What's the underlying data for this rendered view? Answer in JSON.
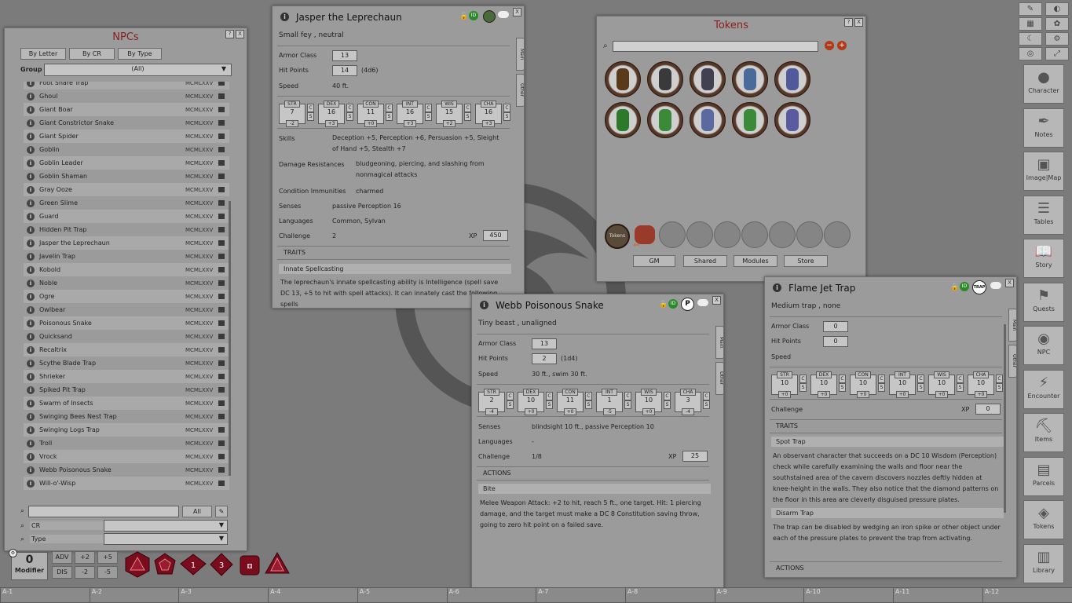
{
  "npcs": {
    "title": "NPCs",
    "filters": [
      "By Letter",
      "By CR",
      "By Type"
    ],
    "group_label": "Group",
    "group_value": "(All)",
    "items": [
      {
        "name": "Foot Snare Trap",
        "v": "MCMLXXV"
      },
      {
        "name": "Ghoul",
        "v": "MCMLXXV"
      },
      {
        "name": "Giant Boar",
        "v": "MCMLXXV"
      },
      {
        "name": "Giant Constrictor Snake",
        "v": "MCMLXXV"
      },
      {
        "name": "Giant Spider",
        "v": "MCMLXXV"
      },
      {
        "name": "Goblin",
        "v": "MCMLXXV"
      },
      {
        "name": "Goblin Leader",
        "v": "MCMLXXV"
      },
      {
        "name": "Goblin Shaman",
        "v": "MCMLXXV"
      },
      {
        "name": "Gray Ooze",
        "v": "MCMLXXV"
      },
      {
        "name": "Green Slime",
        "v": "MCMLXXV"
      },
      {
        "name": "Guard",
        "v": "MCMLXXV"
      },
      {
        "name": "Hidden Pit Trap",
        "v": "MCMLXXV"
      },
      {
        "name": "Jasper the Leprechaun",
        "v": "MCMLXXV"
      },
      {
        "name": "Javelin Trap",
        "v": "MCMLXXV"
      },
      {
        "name": "Kobold",
        "v": "MCMLXXV"
      },
      {
        "name": "Noble",
        "v": "MCMLXXV"
      },
      {
        "name": "Ogre",
        "v": "MCMLXXV"
      },
      {
        "name": "Owlbear",
        "v": "MCMLXXV"
      },
      {
        "name": "Poisonous Snake",
        "v": "MCMLXXV"
      },
      {
        "name": "Quicksand",
        "v": "MCMLXXV"
      },
      {
        "name": "Recaltrix",
        "v": "MCMLXXV"
      },
      {
        "name": "Scythe Blade Trap",
        "v": "MCMLXXV"
      },
      {
        "name": "Shrieker",
        "v": "MCMLXXV"
      },
      {
        "name": "Spiked Pit Trap",
        "v": "MCMLXXV"
      },
      {
        "name": "Swarm of Insects",
        "v": "MCMLXXV"
      },
      {
        "name": "Swinging Bees Nest Trap",
        "v": "MCMLXXV"
      },
      {
        "name": "Swinging Logs Trap",
        "v": "MCMLXXV"
      },
      {
        "name": "Troll",
        "v": "MCMLXXV"
      },
      {
        "name": "Vrock",
        "v": "MCMLXXV"
      },
      {
        "name": "Webb Poisonous Snake",
        "v": "MCMLXXV"
      },
      {
        "name": "Will-o'-Wisp",
        "v": "MCMLXXV"
      }
    ],
    "all_btn": "All",
    "cr_label": "CR",
    "type_label": "Type"
  },
  "jasper": {
    "title": "Jasper the Leprechaun",
    "subtitle": "Small fey , neutral",
    "ac_label": "Armor Class",
    "ac": "13",
    "hp_label": "Hit Points",
    "hp": "14",
    "hp_dice": "(4d6)",
    "speed_label": "Speed",
    "speed": "40 ft.",
    "abilities": [
      {
        "n": "STR",
        "v": "7",
        "m": "-2"
      },
      {
        "n": "DEX",
        "v": "16",
        "m": "+3"
      },
      {
        "n": "CON",
        "v": "11",
        "m": "+0"
      },
      {
        "n": "INT",
        "v": "16",
        "m": "+3"
      },
      {
        "n": "WIS",
        "v": "15",
        "m": "+2"
      },
      {
        "n": "CHA",
        "v": "16",
        "m": "+3"
      }
    ],
    "skills_label": "Skills",
    "skills": "Deception +5, Perception +6, Persuasion +5, Sleight of Hand +5, Stealth +7",
    "dr_label": "Damage Resistances",
    "dr": "bludgeoning, piercing, and slashing from nonmagical attacks",
    "ci_label": "Condition Immunities",
    "ci": "charmed",
    "senses_label": "Senses",
    "senses": "passive Perception 16",
    "lang_label": "Languages",
    "lang": "Common, Sylvan",
    "chal_label": "Challenge",
    "chal": "2",
    "xp_label": "XP",
    "xp": "450",
    "traits": "TRAITS",
    "trait1": "Innate Spellcasting",
    "trait1_text": "The leprechaun's innate spellcasting ability is Intelligence (spell save DC 13, +5 to hit with spell attacks). It can innately cast the following spells",
    "tab_main": "Main",
    "tab_other": "Other"
  },
  "tokens": {
    "title": "Tokens",
    "buttons": [
      "GM",
      "Shared",
      "Modules",
      "Store"
    ],
    "token_label": "Tokens"
  },
  "webb": {
    "title": "Webb Poisonous Snake",
    "subtitle": "Tiny beast , unaligned",
    "ac_label": "Armor Class",
    "ac": "13",
    "hp_label": "Hit Points",
    "hp": "2",
    "hp_dice": "(1d4)",
    "speed_label": "Speed",
    "speed": "30 ft., swim 30 ft.",
    "abilities": [
      {
        "n": "STR",
        "v": "2",
        "m": "-4"
      },
      {
        "n": "DEX",
        "v": "10",
        "m": "+0"
      },
      {
        "n": "CON",
        "v": "11",
        "m": "+0"
      },
      {
        "n": "INT",
        "v": "1",
        "m": "-5"
      },
      {
        "n": "WIS",
        "v": "10",
        "m": "+0"
      },
      {
        "n": "CHA",
        "v": "3",
        "m": "-4"
      }
    ],
    "senses_label": "Senses",
    "senses": "blindsight 10 ft., passive Perception 10",
    "lang_label": "Languages",
    "lang": "-",
    "chal_label": "Challenge",
    "chal": "1/8",
    "xp_label": "XP",
    "xp": "25",
    "actions": "ACTIONS",
    "action1": "Bite",
    "action1_text": "Melee Weapon Attack: +2 to hit, reach 5 ft., one target. Hit: 1 piercing damage, and the target must make a DC 8 Constitution saving throw, going to zero hit point on a failed save.",
    "tab_main": "Main",
    "tab_other": "Other"
  },
  "flame": {
    "title": "Flame Jet Trap",
    "subtitle": "Medium trap , none",
    "ac_label": "Armor Class",
    "ac": "0",
    "hp_label": "Hit Points",
    "hp": "0",
    "speed_label": "Speed",
    "abilities": [
      {
        "n": "STR",
        "v": "10",
        "m": "+0"
      },
      {
        "n": "DEX",
        "v": "10",
        "m": "+0"
      },
      {
        "n": "CON",
        "v": "10",
        "m": "+0"
      },
      {
        "n": "INT",
        "v": "10",
        "m": "+0"
      },
      {
        "n": "WIS",
        "v": "10",
        "m": "+0"
      },
      {
        "n": "CHA",
        "v": "10",
        "m": "+0"
      }
    ],
    "chal_label": "Challenge",
    "xp_label": "XP",
    "xp": "0",
    "traits": "TRAITS",
    "trait1": "Spot Trap",
    "trait1_text": "An observant character that succeeds on a DC 10 Wisdom (Perception) check while carefully examining the walls and floor near the southstained area of the cavern discovers nozzles deftly hidden at knee-height in the walls. They also notice that the diamond patterns on the floor in this area are cleverly disguised pressure plates.",
    "trait2": "Disarm Trap",
    "trait2_text": "The trap can be disabled by wedging an iron spike or other object under each of the pressure plates to prevent the trap from activating.",
    "actions": "ACTIONS",
    "badge": "TRAP",
    "tab_main": "Main",
    "tab_other": "Other"
  },
  "sidebar": [
    {
      "label": "Character",
      "icon": "person-icon"
    },
    {
      "label": "Notes",
      "icon": "quill-icon"
    },
    {
      "label": "Image|Map",
      "icon": "image-icon"
    },
    {
      "label": "Tables",
      "icon": "list-icon"
    },
    {
      "label": "Story",
      "icon": "book-icon"
    },
    {
      "label": "Quests",
      "icon": "flag-icon"
    },
    {
      "label": "NPC",
      "icon": "npc-icon"
    },
    {
      "label": "Encounter",
      "icon": "lightning-icon"
    },
    {
      "label": "Items",
      "icon": "anvil-icon"
    },
    {
      "label": "Parcels",
      "icon": "box-icon"
    },
    {
      "label": "Tokens",
      "icon": "layers-icon"
    },
    {
      "label": "Library",
      "icon": "library-icon"
    }
  ],
  "modifier": {
    "value": "0",
    "label": "Modifier",
    "adv": "ADV",
    "dis": "DIS",
    "p2": "+2",
    "p5": "+5",
    "m2": "-2",
    "m5": "-5"
  },
  "dice": [
    "d20",
    "d12",
    "d10",
    "d8",
    "d6",
    "d4"
  ],
  "hotbar": [
    "A-1",
    "A-2",
    "A-3",
    "A-4",
    "A-5",
    "A-6",
    "A-7",
    "A-8",
    "A-9",
    "A-10",
    "A-11",
    "A-12"
  ]
}
